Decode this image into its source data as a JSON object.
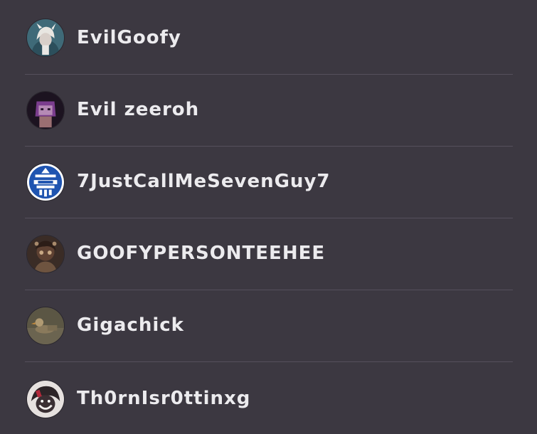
{
  "users": [
    {
      "name": "EvilGoofy",
      "avatar_icon": "white-haired-character-avatar-icon",
      "avatar_color": "#3f6a78"
    },
    {
      "name": "Evil zeeroh",
      "avatar_icon": "purple-character-avatar-icon",
      "avatar_color": "#1c1320"
    },
    {
      "name": "7JustCallMeSevenGuy7",
      "avatar_icon": "blue-emblem-avatar-icon",
      "avatar_color": "#1f54b0"
    },
    {
      "name": "GOOFYPERSONTEEHEE",
      "avatar_icon": "brown-character-avatar-icon",
      "avatar_color": "#3a2c26"
    },
    {
      "name": "Gigachick",
      "avatar_icon": "blurry-bird-avatar-icon",
      "avatar_color": "#5b5644"
    },
    {
      "name": "Th0rnIsr0ttinxg",
      "avatar_icon": "dark-character-avatar-icon",
      "avatar_color": "#3a2f33"
    }
  ]
}
